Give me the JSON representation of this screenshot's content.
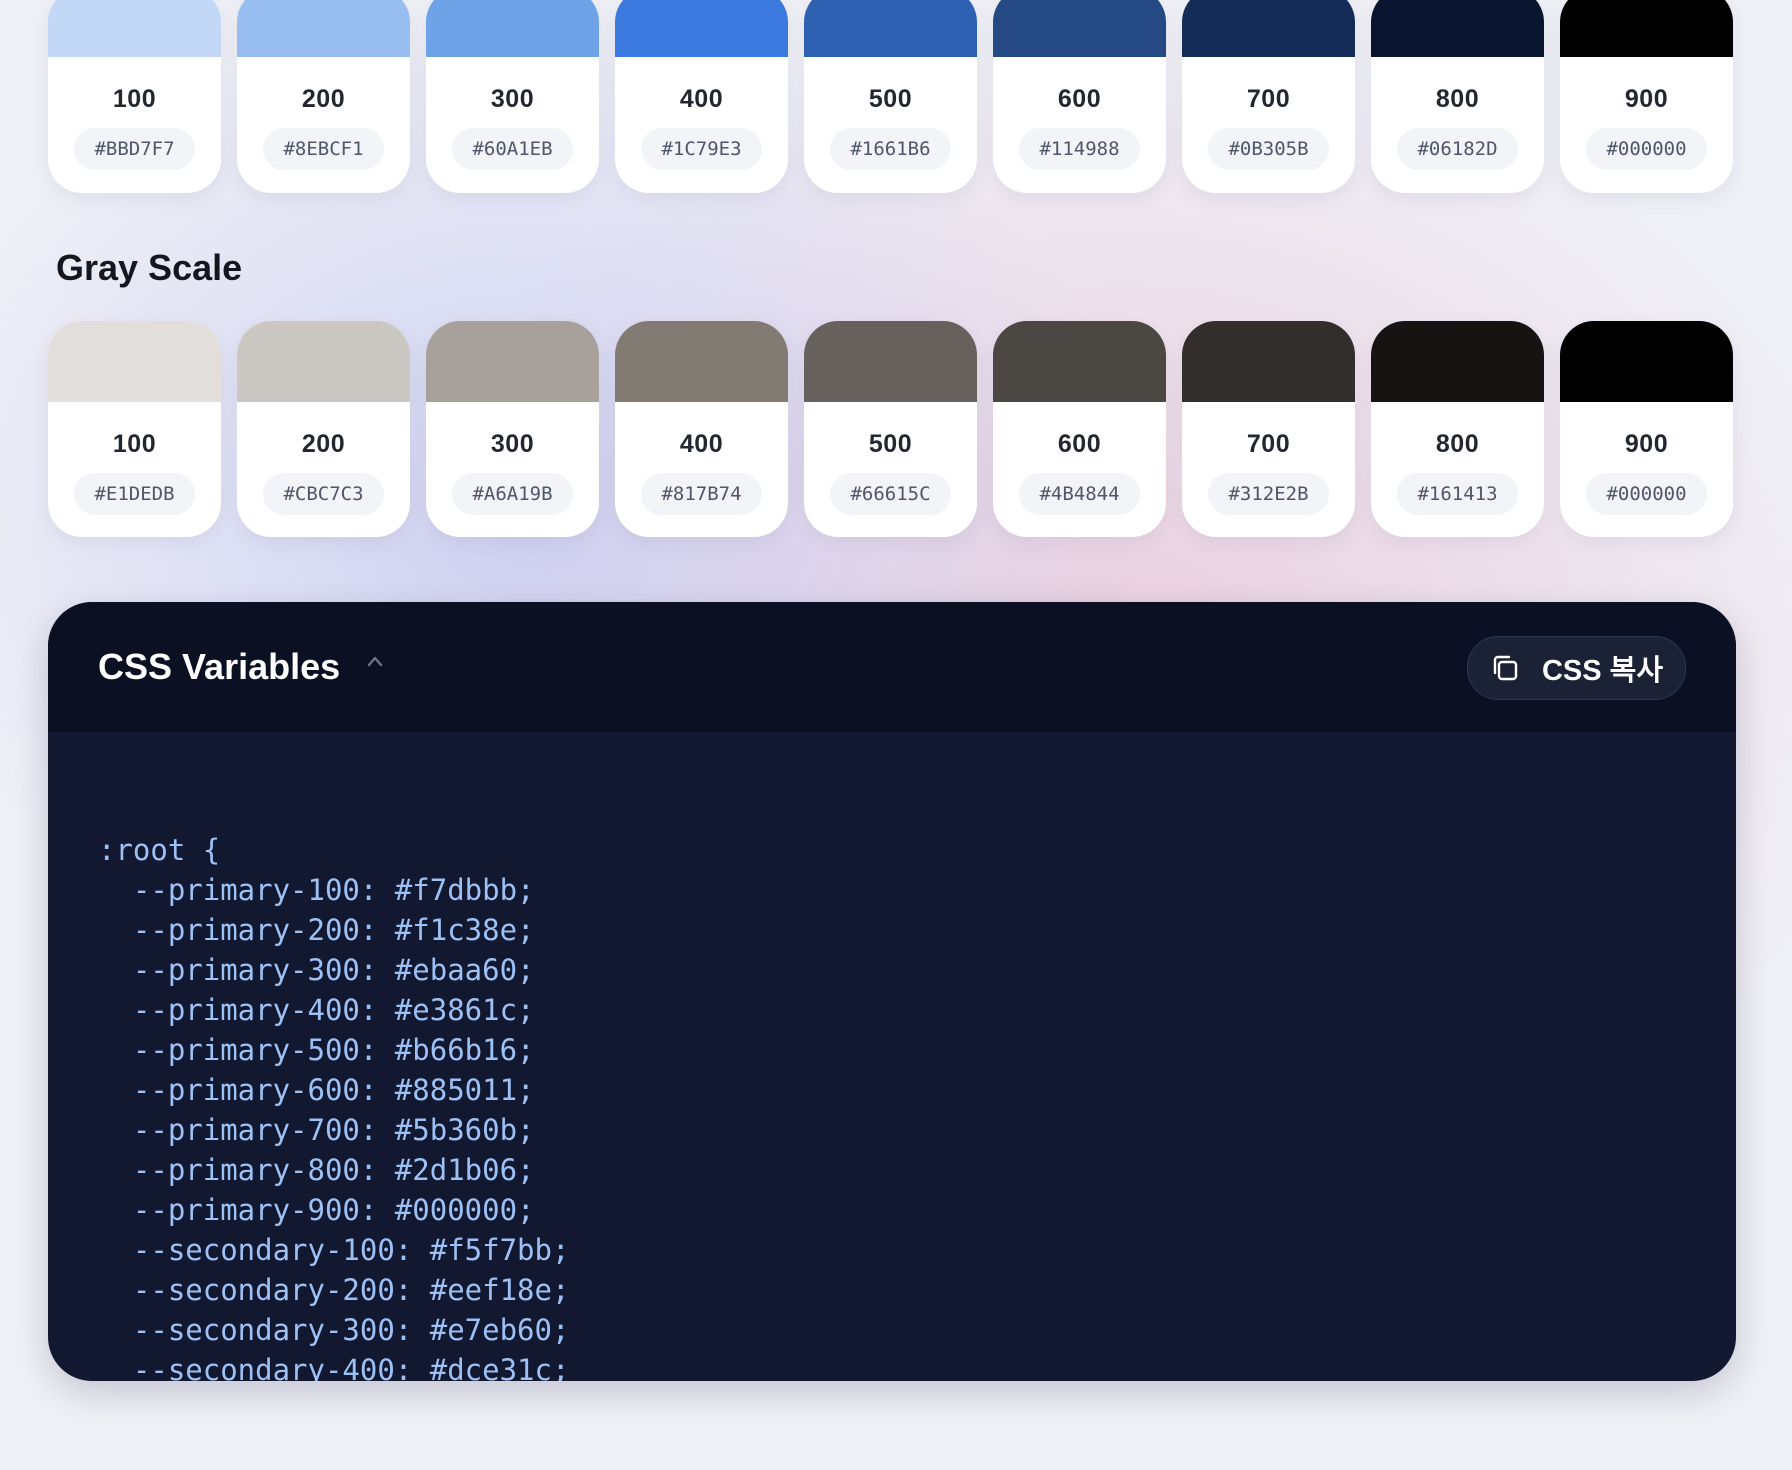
{
  "blue_scale": {
    "swatches": [
      {
        "step": "100",
        "hex": "#BBD7F7",
        "color": "#c2d8f6"
      },
      {
        "step": "200",
        "hex": "#8EBCF1",
        "color": "#98bdf0"
      },
      {
        "step": "300",
        "hex": "#60A1EB",
        "color": "#6ea3e7"
      },
      {
        "step": "400",
        "hex": "#1C79E3",
        "color": "#3b79de"
      },
      {
        "step": "500",
        "hex": "#1661B6",
        "color": "#2e61b2"
      },
      {
        "step": "600",
        "hex": "#114988",
        "color": "#254985"
      },
      {
        "step": "700",
        "hex": "#0B305B",
        "color": "#142d58"
      },
      {
        "step": "800",
        "hex": "#06182D",
        "color": "#0a1630"
      },
      {
        "step": "900",
        "hex": "#000000",
        "color": "#000000"
      }
    ]
  },
  "gray_scale": {
    "title": "Gray Scale",
    "swatches": [
      {
        "step": "100",
        "hex": "#E1DEDB",
        "color": "#e1dedb"
      },
      {
        "step": "200",
        "hex": "#CBC7C3",
        "color": "#cbc7c3"
      },
      {
        "step": "300",
        "hex": "#A6A19B",
        "color": "#a6a19b"
      },
      {
        "step": "400",
        "hex": "#817B74",
        "color": "#817b74"
      },
      {
        "step": "500",
        "hex": "#66615C",
        "color": "#66615c"
      },
      {
        "step": "600",
        "hex": "#4B4844",
        "color": "#4b4844"
      },
      {
        "step": "700",
        "hex": "#312E2B",
        "color": "#312e2b"
      },
      {
        "step": "800",
        "hex": "#161413",
        "color": "#161413"
      },
      {
        "step": "900",
        "hex": "#000000",
        "color": "#000000"
      }
    ]
  },
  "css_panel": {
    "title": "CSS Variables",
    "toggle_icon": "chevron-up-icon",
    "copy_icon": "copy-icon",
    "copy_label": "CSS 복사",
    "code": ":root {\n  --primary-100: #f7dbbb;\n  --primary-200: #f1c38e;\n  --primary-300: #ebaa60;\n  --primary-400: #e3861c;\n  --primary-500: #b66b16;\n  --primary-600: #885011;\n  --primary-700: #5b360b;\n  --primary-800: #2d1b06;\n  --primary-900: #000000;\n  --secondary-100: #f5f7bb;\n  --secondary-200: #eef18e;\n  --secondary-300: #e7eb60;\n  --secondary-400: #dce31c;"
  }
}
